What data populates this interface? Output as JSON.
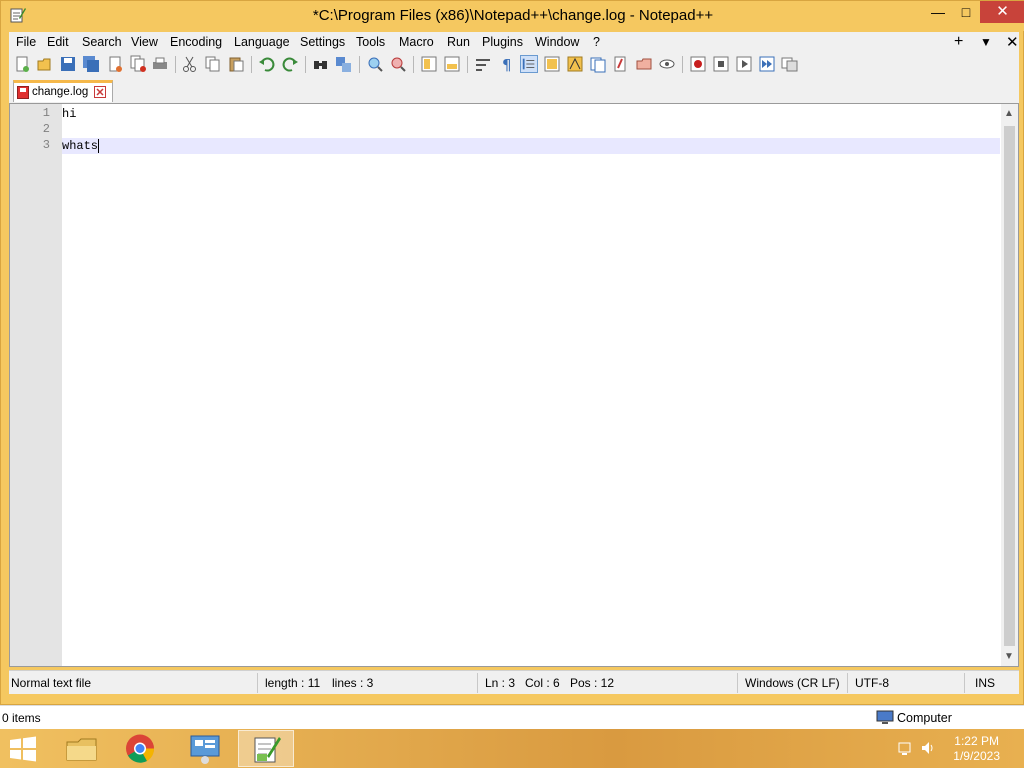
{
  "window": {
    "title": "*C:\\Program Files (x86)\\Notepad++\\change.log - Notepad++"
  },
  "menu": {
    "items": [
      "File",
      "Edit",
      "Search",
      "View",
      "Encoding",
      "Language",
      "Settings",
      "Tools",
      "Macro",
      "Run",
      "Plugins",
      "Window",
      "?"
    ],
    "right": {
      "plus": "+",
      "down": "▼",
      "close": "✕"
    }
  },
  "toolbar": {
    "icons": [
      "new-file-icon",
      "open-file-icon",
      "save-icon",
      "save-all-icon",
      "close-icon",
      "close-all-icon",
      "print-icon",
      "cut-icon",
      "copy-icon",
      "paste-icon",
      "undo-icon",
      "redo-icon",
      "find-icon",
      "replace-icon",
      "zoom-in-icon",
      "zoom-out-icon",
      "sync-vertical-icon",
      "sync-horizontal-icon",
      "word-wrap-icon",
      "show-all-chars-icon",
      "indent-guide-icon",
      "udl-icon",
      "document-map-icon",
      "function-list-icon",
      "folder-workspace-icon",
      "monitoring-icon",
      "record-macro-icon",
      "stop-recording-icon",
      "play-macro-icon",
      "run-macro-multiple-icon",
      "save-macro-icon"
    ]
  },
  "tab": {
    "label": "change.log"
  },
  "editor": {
    "line_numbers": [
      "1",
      "2",
      "3"
    ],
    "lines": [
      "hi",
      "",
      "whats"
    ]
  },
  "status": {
    "file_type": "Normal text file",
    "length": "length : 11",
    "lines": "lines : 3",
    "ln": "Ln : 3",
    "col": "Col : 6",
    "pos": "Pos : 12",
    "eol": "Windows (CR LF)",
    "encoding": "UTF-8",
    "mode": "INS"
  },
  "explorer": {
    "items": "0 items",
    "computer": "Computer"
  },
  "taskbar": {
    "time": "1:22 PM",
    "date": "1/9/2023"
  },
  "colors": {
    "title_bg": "#f5c860",
    "close_btn": "#c8433a",
    "current_line": "#e8e8ff",
    "gutter": "#e4e4e4"
  }
}
